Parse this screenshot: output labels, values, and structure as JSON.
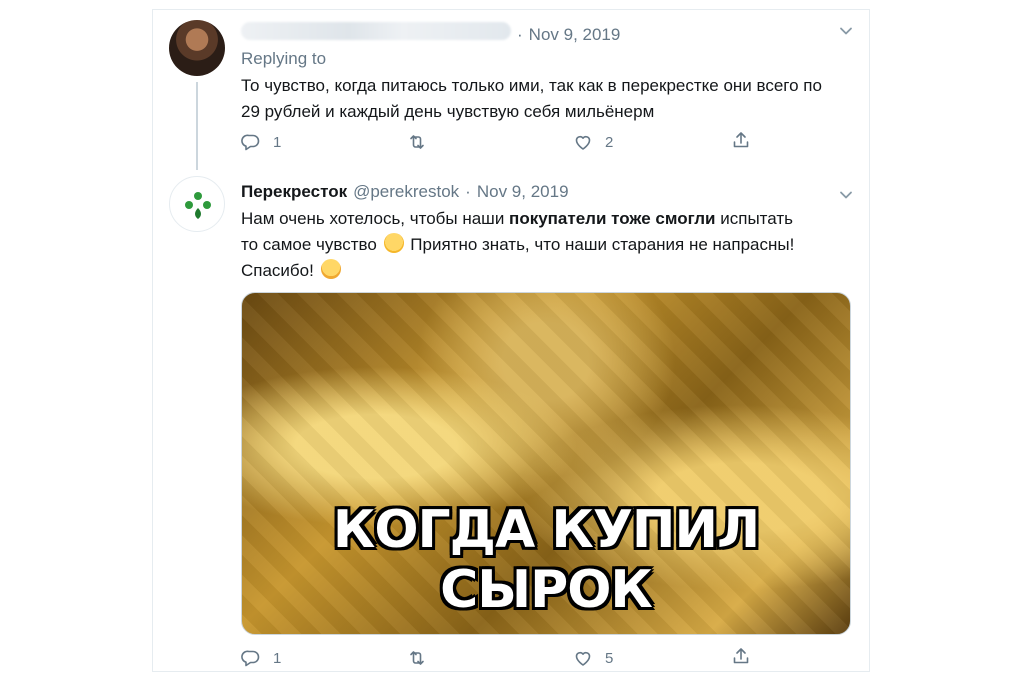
{
  "reply_tweet": {
    "date": "Nov 9, 2019",
    "separator": "·",
    "replying_label": "Replying to",
    "text": "То чувство,  когда питаюсь только ими, так как в перекрестке они всего по 29 рублей и каждый день чувствую себя мильёнерм",
    "actions": {
      "reply_count": "1",
      "retweet_count": "",
      "like_count": "2"
    }
  },
  "brand_tweet": {
    "name": "Перекресток",
    "handle": "@perekrestok",
    "separator": "·",
    "date": "Nov 9, 2019",
    "text_part1": "Нам очень хотелось, чтобы наши ",
    "text_bold": "покупатели тоже смогли",
    "text_part2": " испытать",
    "text_part3": "то самое чувство ",
    "text_part4": " Приятно знать, что наши старания не напрасны! Спасибо! ",
    "media_caption": "КОГДА КУПИЛ СЫРОК",
    "actions": {
      "reply_count": "1",
      "retweet_count": "",
      "like_count": "5"
    }
  },
  "icons": {
    "reply": "reply-icon",
    "retweet": "retweet-icon",
    "like": "heart-icon",
    "share": "share-icon",
    "menu": "chevron-down-icon"
  },
  "colors": {
    "brand_green": "#2e9a3c",
    "muted": "#657786",
    "border": "#e6ecf0"
  }
}
